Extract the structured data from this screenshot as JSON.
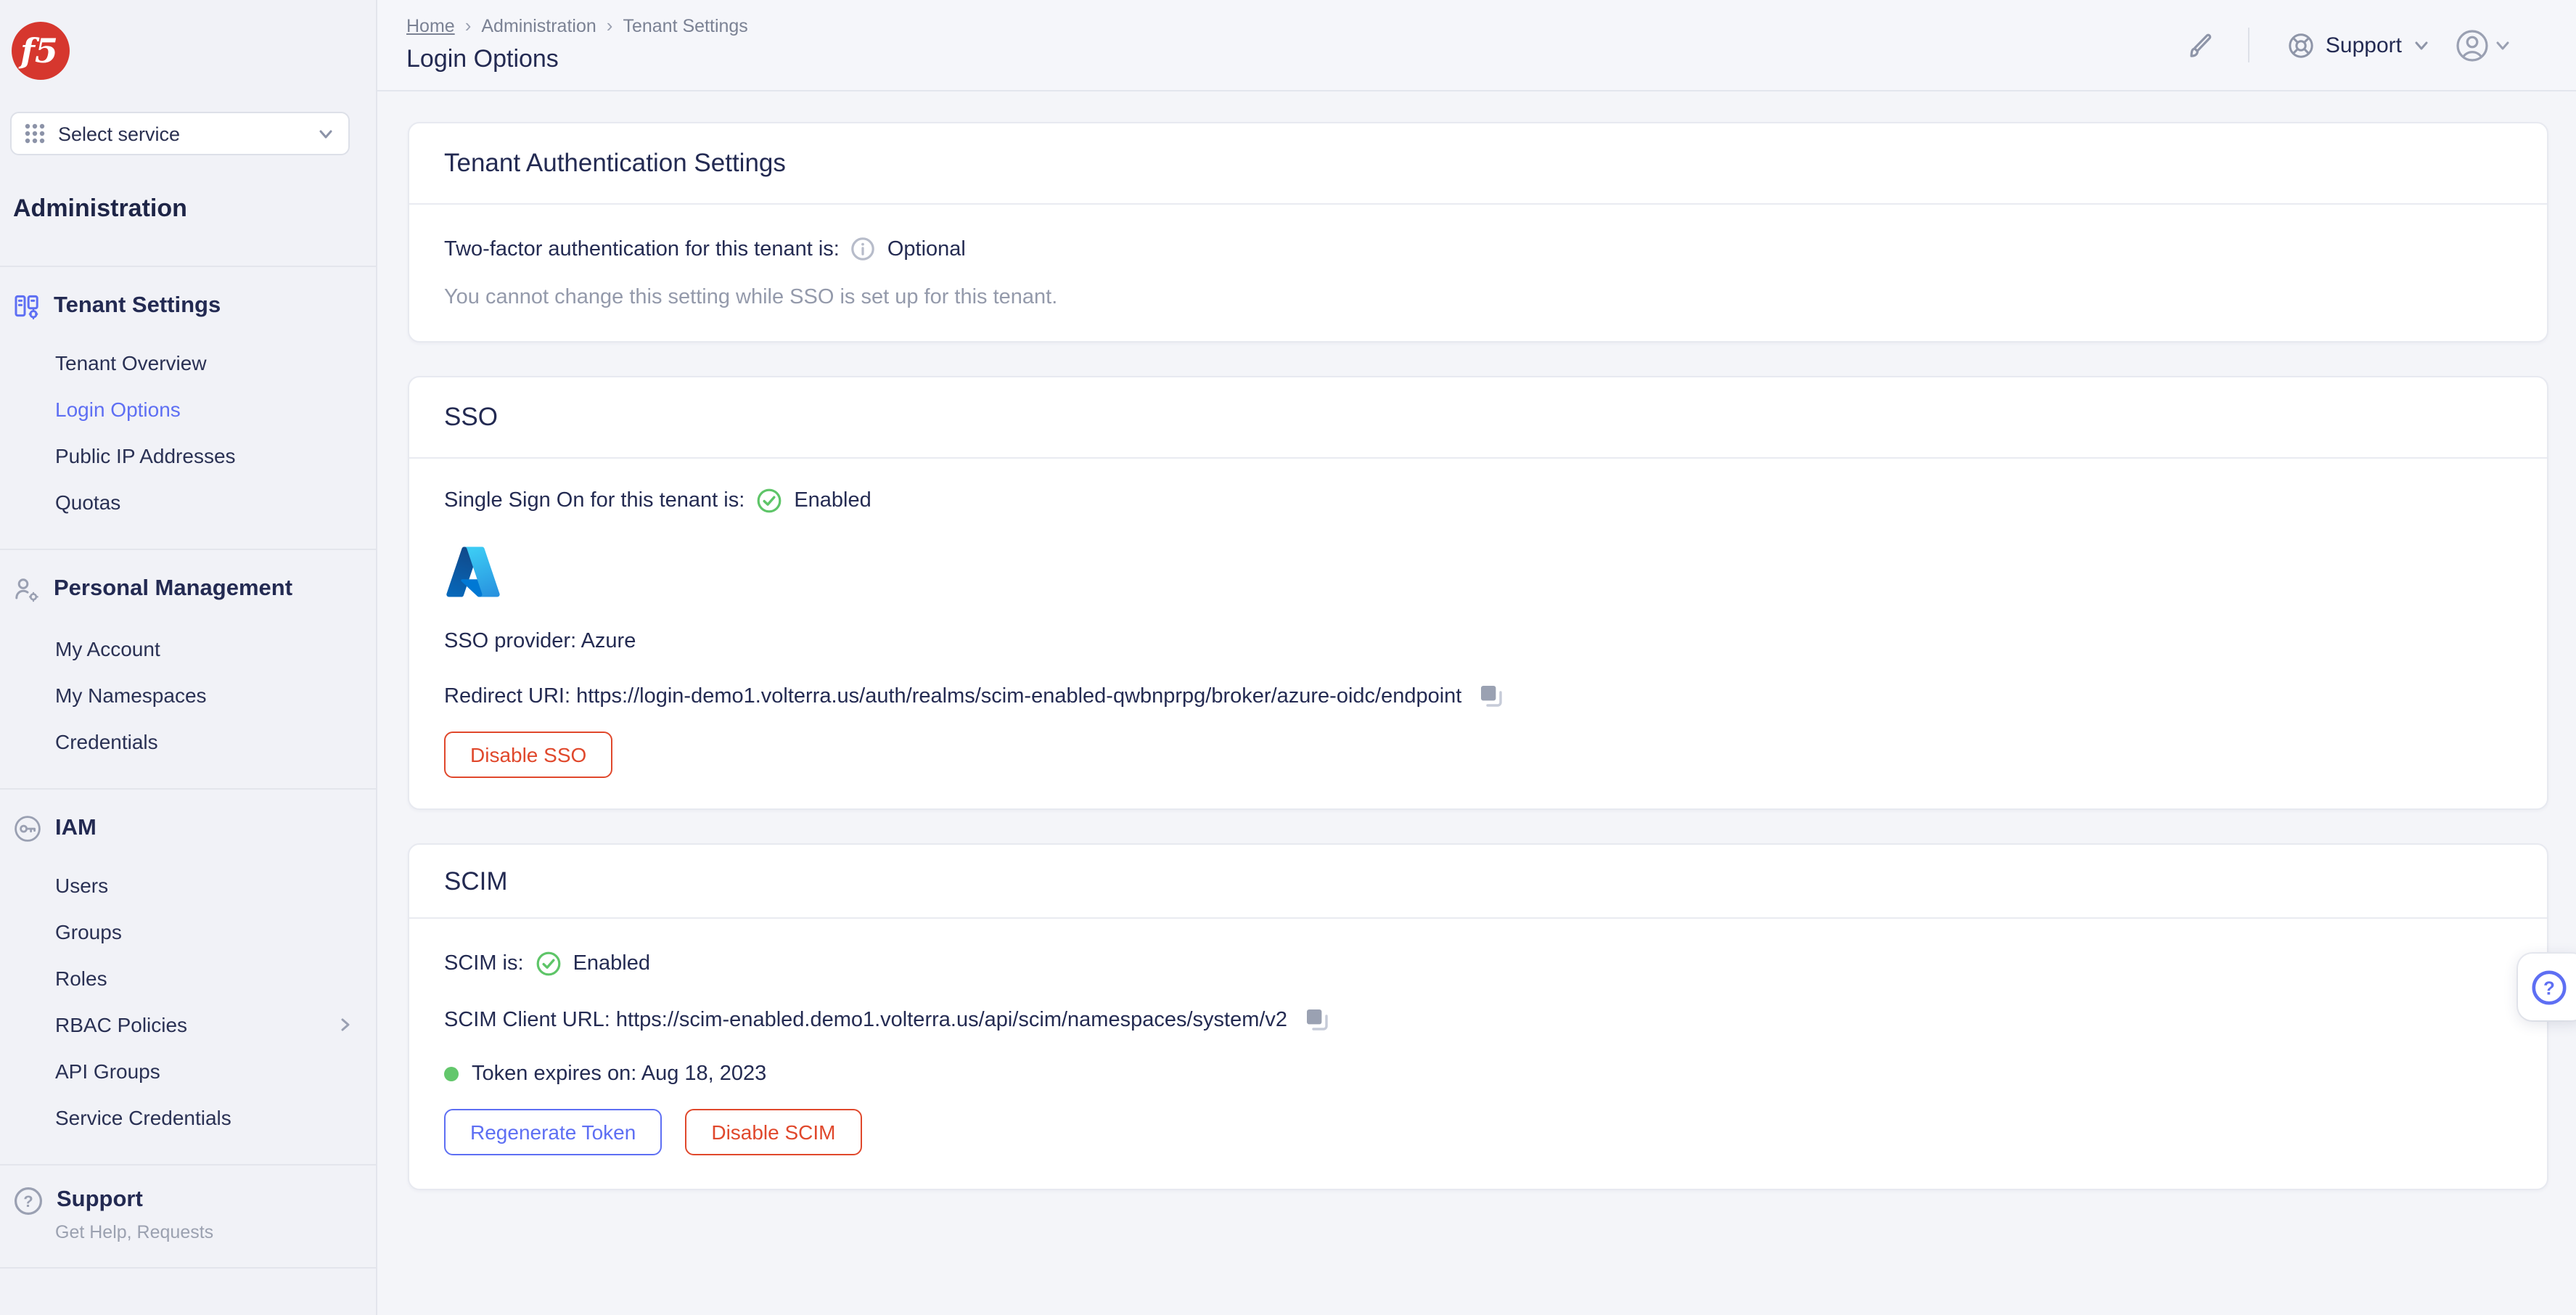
{
  "brand": {
    "logo_text": "f5"
  },
  "sidebar": {
    "select_service": "Select service",
    "heading": "Administration",
    "nav": [
      {
        "label": "Tenant Settings",
        "items": [
          "Tenant Overview",
          "Login Options",
          "Public IP Addresses",
          "Quotas"
        ],
        "active_item": "Login Options"
      },
      {
        "label": "Personal Management",
        "items": [
          "My Account",
          "My Namespaces",
          "Credentials"
        ]
      },
      {
        "label": "IAM",
        "items": [
          "Users",
          "Groups",
          "Roles",
          "RBAC Policies",
          "API Groups",
          "Service Credentials"
        ],
        "expandable_item": "RBAC Policies"
      }
    ],
    "support": {
      "label": "Support",
      "subtitle": "Get Help, Requests"
    }
  },
  "header": {
    "breadcrumb": [
      "Home",
      "Administration",
      "Tenant Settings"
    ],
    "title": "Login Options",
    "support_label": "Support"
  },
  "cards": {
    "auth": {
      "title": "Tenant Authentication Settings",
      "two_factor_label": "Two-factor authentication for this tenant is:",
      "two_factor_value": "Optional",
      "note": "You cannot change this setting while SSO is set up for this tenant."
    },
    "sso": {
      "title": "SSO",
      "status_label": "Single Sign On for this tenant is:",
      "status_value": "Enabled",
      "provider_label": "SSO provider: Azure",
      "redirect_label": "Redirect URI: https://login-demo1.volterra.us/auth/realms/scim-enabled-qwbnprpg/broker/azure-oidc/endpoint",
      "disable_button": "Disable SSO"
    },
    "scim": {
      "title": "SCIM",
      "status_label": "SCIM is:",
      "status_value": "Enabled",
      "client_url_label": "SCIM Client URL: https://scim-enabled.demo1.volterra.us/api/scim/namespaces/system/v2",
      "token_label": "Token expires on: Aug 18, 2023",
      "regenerate_button": "Regenerate Token",
      "disable_button": "Disable SCIM"
    }
  },
  "icons": [
    "f5-logo",
    "grid-icon",
    "chevron-down-icon",
    "tenant-settings-icon",
    "person-gear-icon",
    "key-icon",
    "chevron-right-icon",
    "question-circle-icon",
    "brush-icon",
    "lifebuoy-icon",
    "avatar-icon",
    "info-icon",
    "check-circle-icon",
    "copy-icon",
    "azure-logo",
    "status-dot",
    "help-icon"
  ],
  "colors": {
    "accent": "#5E6FF3",
    "danger": "#E0482C",
    "success": "#5EC568",
    "brand_red": "#D6372E",
    "navy": "#252C55",
    "muted": "#949AAB",
    "sidebar_bg": "#F1F2F7",
    "page_bg": "#F4F5F9",
    "card_bg": "#FFFFFF"
  }
}
